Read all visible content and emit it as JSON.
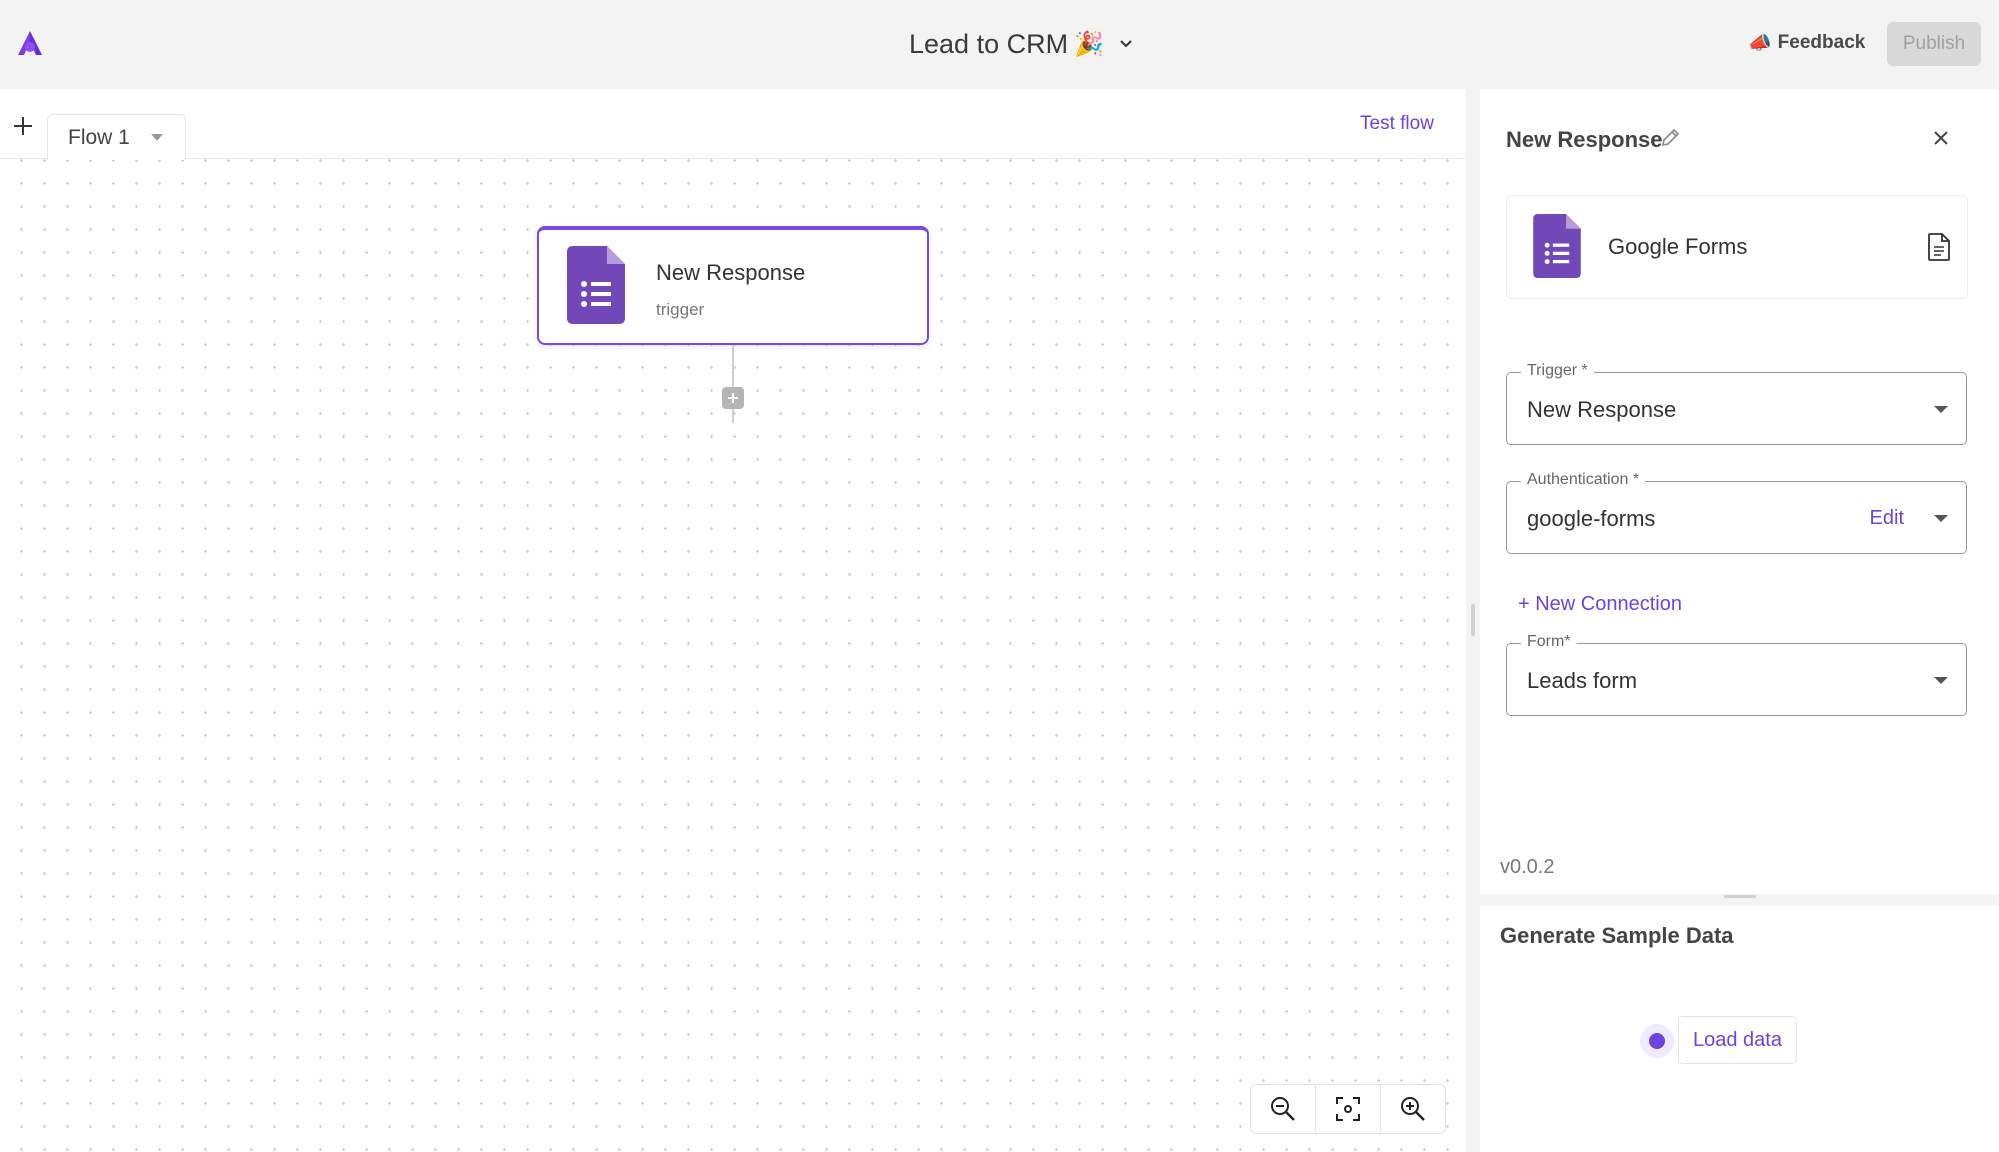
{
  "header": {
    "flow_name": "Lead to CRM",
    "flow_emoji": "🎉",
    "feedback_emoji": "📣",
    "feedback_label": "Feedback",
    "publish_label": "Publish"
  },
  "builder": {
    "tabs": [
      {
        "label": "Flow 1"
      }
    ],
    "test_flow_label": "Test flow",
    "trigger_node": {
      "title": "New Response",
      "subtitle": "trigger"
    }
  },
  "panel": {
    "title": "New Response",
    "piece_name": "Google Forms",
    "fields": {
      "trigger": {
        "label": "Trigger *",
        "value": "New Response"
      },
      "authentication": {
        "label": "Authentication *",
        "value": "google-forms",
        "edit_label": "Edit"
      },
      "form": {
        "label": "Form*",
        "value": "Leads form"
      }
    },
    "new_connection_label": "+ New Connection",
    "version": "v0.0.2"
  },
  "sample_data": {
    "title": "Generate Sample Data",
    "load_label": "Load data"
  },
  "colors": {
    "accent": "#6e41e2",
    "forms_purple": "#7248b9",
    "publish_disabled_bg": "#d9d9d9"
  }
}
